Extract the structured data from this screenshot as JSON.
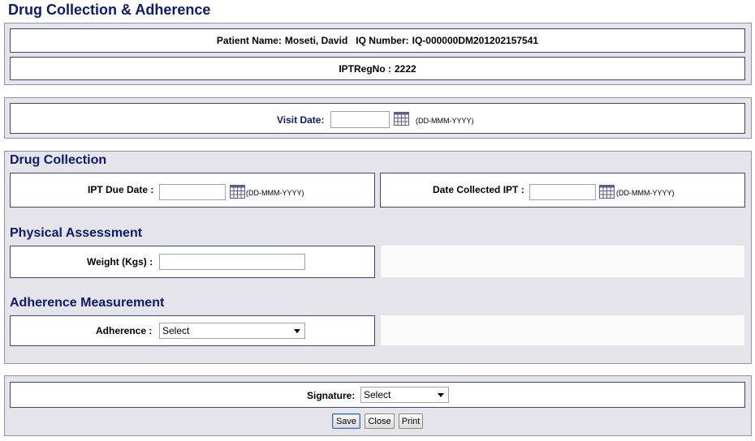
{
  "page": {
    "title": "Drug Collection & Adherence"
  },
  "patient": {
    "name_label": "Patient Name:",
    "name_value": "Moseti, David",
    "iq_label": "IQ Number:",
    "iq_value": "IQ-000000DM201202157541",
    "ipt_reg_label": "IPTRegNo :",
    "ipt_reg_value": "2222"
  },
  "visit": {
    "date_label": "Visit Date:",
    "date_value": "",
    "date_format": "(DD-MMM-YYYY)"
  },
  "drug_collection": {
    "heading": "Drug Collection",
    "ipt_due_label": "IPT Due Date :",
    "ipt_due_value": "",
    "ipt_due_format": "(DD-MMM-YYYY)",
    "collected_label": "Date Collected IPT :",
    "collected_value": "",
    "collected_format": "(DD-MMM-YYYY)"
  },
  "physical": {
    "heading": "Physical Assessment",
    "weight_label": "Weight (Kgs) :",
    "weight_value": ""
  },
  "adherence": {
    "heading": "Adherence Measurement",
    "label": "Adherence :",
    "selected": "Select"
  },
  "signature": {
    "label": "Signature:",
    "selected": "Select"
  },
  "buttons": {
    "save": "Save",
    "close": "Close",
    "print": "Print"
  },
  "icons": {
    "calendar": "calendar-icon",
    "dropdown": "chevron-down-icon"
  },
  "colors": {
    "heading": "#0b1a6b",
    "panel": "#e4e4ea",
    "box_border": "#3f4673"
  }
}
